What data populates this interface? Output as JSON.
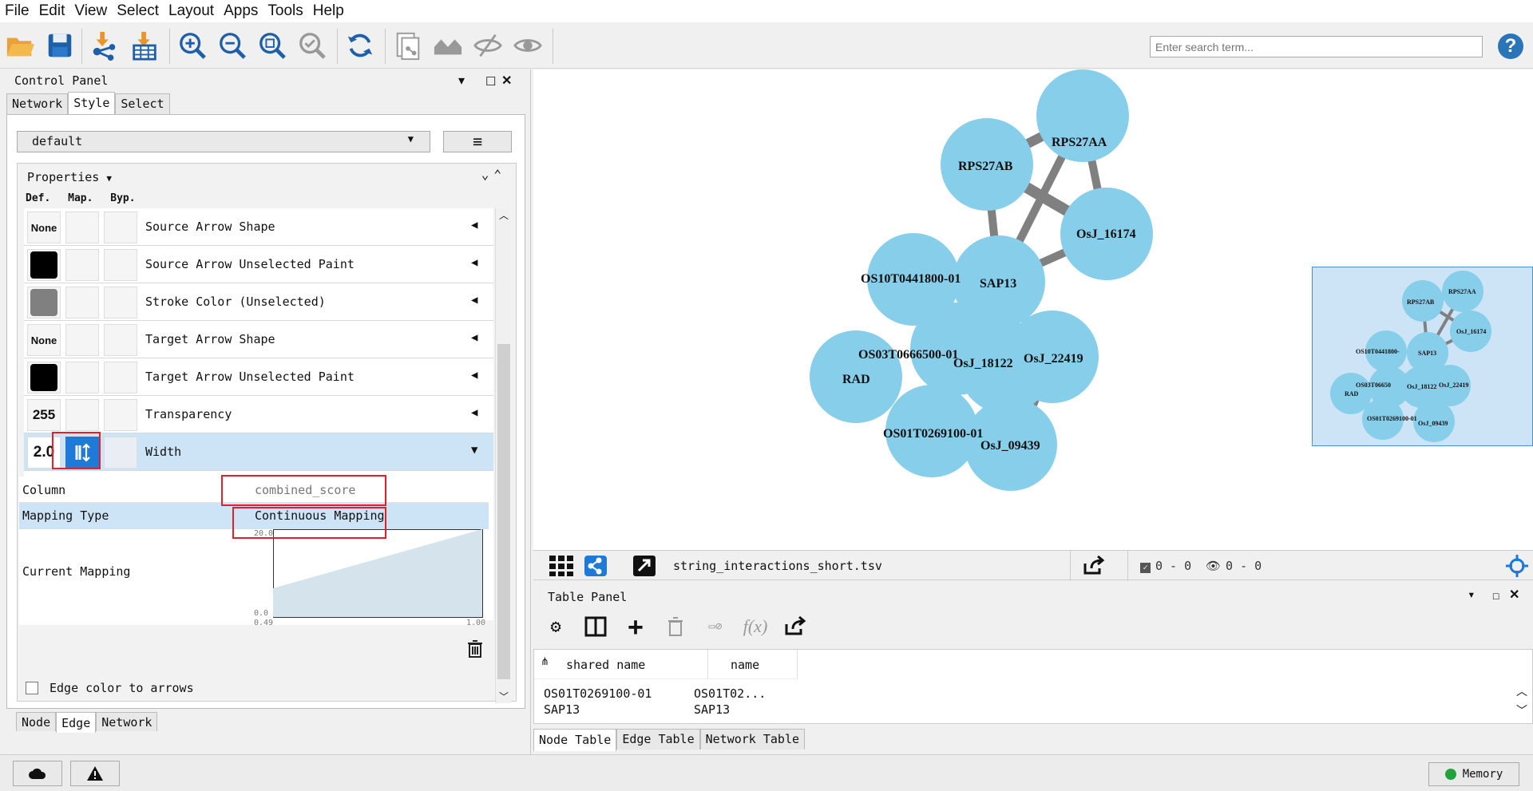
{
  "menu": [
    "File",
    "Edit",
    "View",
    "Select",
    "Layout",
    "Apps",
    "Tools",
    "Help"
  ],
  "toolbar": {
    "search_placeholder": "Enter search term...",
    "help_label": "?",
    "icons": [
      "open-folder-icon",
      "save-icon",
      "import-network-icon",
      "import-table-icon",
      "zoom-in-icon",
      "zoom-out-icon",
      "zoom-fit-icon",
      "zoom-selected-icon",
      "refresh-icon",
      "new-network-icon",
      "home-icon",
      "hide-icon",
      "show-icon"
    ]
  },
  "control_panel": {
    "title": "Control Panel",
    "tabs": [
      "Network",
      "Style",
      "Select"
    ],
    "selected_tab": "Style",
    "style_dropdown": "default",
    "properties_label": "Properties",
    "col_headers": [
      "Def.",
      "Map.",
      "Byp."
    ],
    "visual_props": [
      {
        "default": "None",
        "label": "Source Arrow Shape"
      },
      {
        "default_color": "#000000",
        "label": "Source Arrow Unselected Paint"
      },
      {
        "default_color": "#808080",
        "label": "Stroke Color (Unselected)"
      },
      {
        "default": "None",
        "label": "Target Arrow Shape"
      },
      {
        "default_color": "#000000",
        "label": "Target Arrow Unselected Paint"
      },
      {
        "default": "255",
        "label": "Transparency"
      },
      {
        "default": "2.0",
        "label": "Width"
      }
    ],
    "mapping": {
      "column_label": "Column",
      "column_value": "combined_score",
      "type_label": "Mapping Type",
      "type_value": "Continuous Mapping",
      "current_label": "Current Mapping",
      "y_max": "20.0",
      "y_min": "0.0",
      "x_min": "0.49",
      "x_max": "1.00"
    },
    "edge_color_to_arrows": "Edge color to arrows",
    "bottom_tabs": [
      "Node",
      "Edge",
      "Network"
    ],
    "bottom_selected": "Edge"
  },
  "network": {
    "file_name": "string_interactions_short.tsv",
    "selected_nodes": "0 - 0",
    "selected_edges": "0 - 0",
    "nodes": [
      "RPS27AB",
      "RPS27AA",
      "OsJ_16174",
      "OS10T0441800-01",
      "SAP13",
      "OS03T0666500-01",
      "OsJ_18122",
      "OsJ_22419",
      "RAD",
      "OS01T0269100-01",
      "OsJ_09439"
    ],
    "node_labels_overview": [
      "RPS27AB",
      "RPS27AA",
      "OsJ_16174",
      "OS10T0441800-",
      "SAP13",
      "OS03T06650",
      "OsJ_18122",
      "OsJ_22419",
      "RAD",
      "OS01T0269100-01",
      "OsJ_09439"
    ],
    "node_color": "#87ceeb"
  },
  "table_panel": {
    "title": "Table Panel",
    "columns": [
      "shared name",
      "name"
    ],
    "rows": [
      [
        "OS01T0269100-01",
        "OS01T02..."
      ],
      [
        "SAP13",
        "SAP13"
      ]
    ],
    "tabs": [
      "Node Table",
      "Edge Table",
      "Network Table"
    ],
    "selected_tab": "Node Table"
  },
  "status": {
    "memory_label": "Memory"
  }
}
